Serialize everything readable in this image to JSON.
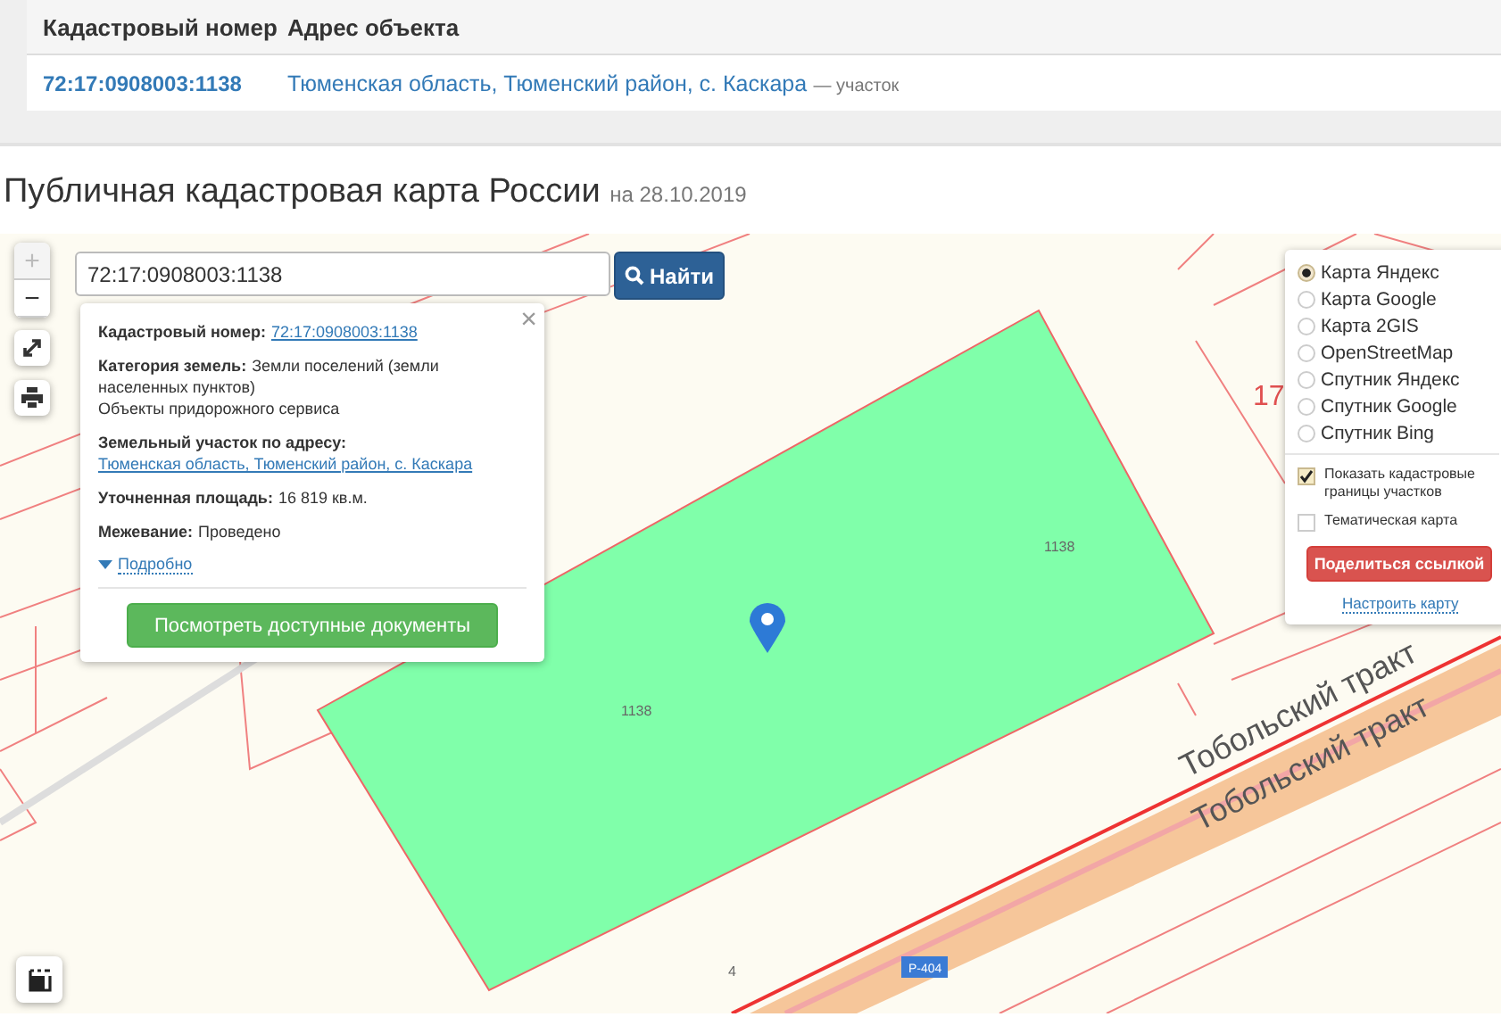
{
  "results_table": {
    "columns": [
      "Кадастровый номер",
      "Адрес объекта"
    ],
    "rows": [
      {
        "number": "72:17:0908003:1138",
        "address": "Тюменская область, Тюменский район, с. Каскара",
        "type": "— участок"
      }
    ]
  },
  "heading": {
    "title": "Публичная кадастровая карта России",
    "date": "на 28.10.2019"
  },
  "map": {
    "search": {
      "value": "72:17:0908003:1138",
      "button": "Найти"
    },
    "zoom": {
      "plus": "+",
      "minus": "−"
    },
    "labels": [
      {
        "text": "1138",
        "kind": "parcel"
      },
      {
        "text": "1138",
        "kind": "parcel"
      },
      {
        "text": "17",
        "kind": "block"
      },
      {
        "text": "Тобольский тракт",
        "kind": "road"
      },
      {
        "text": "Тобольский тракт",
        "kind": "road"
      },
      {
        "text": "4",
        "kind": "parcel"
      },
      {
        "text": "Р-404",
        "kind": "sign"
      }
    ],
    "popup": {
      "close": "×",
      "fields": [
        {
          "label": "Кадастровый номер:",
          "value": "72:17:0908003:1138",
          "link": true
        },
        {
          "label": "Категория земель:",
          "value": "Земли поселений (земли населенных пунктов)\nОбъекты придорожного сервиса",
          "link": false
        },
        {
          "label": "Земельный участок по адресу:",
          "value": "Тюменская область, Тюменский район, с. Каскара",
          "link": true
        },
        {
          "label": "Уточненная площадь:",
          "value": "16 819 кв.м.",
          "link": false
        },
        {
          "label": "Межевание:",
          "value": "Проведено",
          "link": false
        }
      ],
      "more": "Подробно",
      "button": "Посмотреть доступные документы"
    },
    "layers": [
      {
        "label": "Карта Яндекс",
        "selected": true
      },
      {
        "label": "Карта Google",
        "selected": false
      },
      {
        "label": "Карта 2GIS",
        "selected": false
      },
      {
        "label": "OpenStreetMap",
        "selected": false
      },
      {
        "label": "Спутник Яндекс",
        "selected": false
      },
      {
        "label": "Спутник Google",
        "selected": false
      },
      {
        "label": "Спутник Bing",
        "selected": false
      }
    ],
    "options": [
      {
        "label": "Показать кадастровые границы участков",
        "checked": true
      },
      {
        "label": "Тематическая карта",
        "checked": false
      }
    ],
    "share_button": "Поделиться ссылкой",
    "settings_link": "Настроить карту"
  }
}
